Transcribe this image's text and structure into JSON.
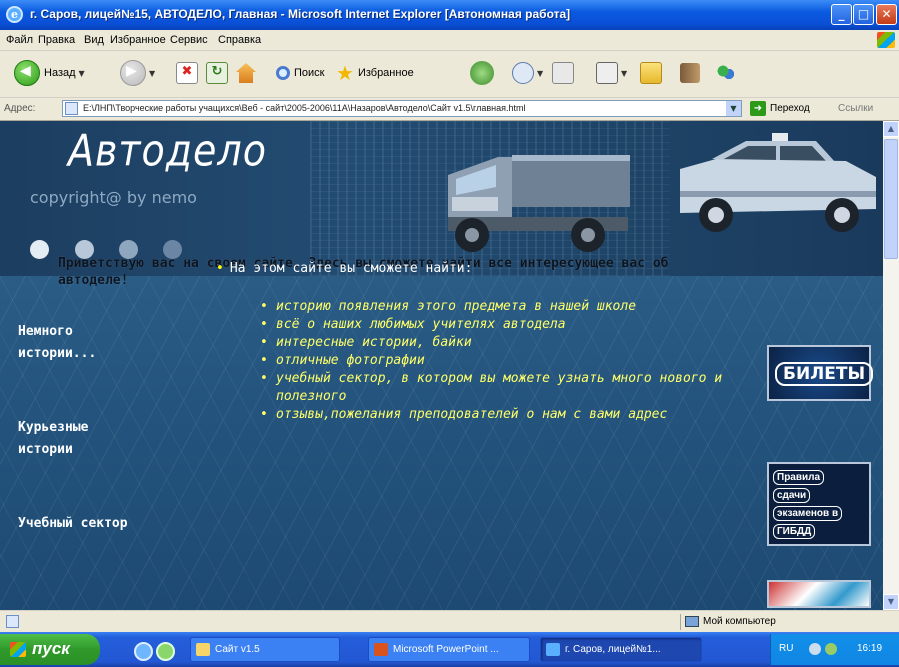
{
  "window": {
    "title": "г. Саров, лицей№15, АВТОДЕЛО, Главная - Microsoft Internet Explorer   [Автономная работа]",
    "min_label": "_",
    "max_label": "□",
    "close_label": "✕"
  },
  "menu": [
    "Файл",
    "Правка",
    "Вид",
    "Избранное",
    "Сервис",
    "Справка"
  ],
  "toolbar": {
    "back_label": "Назад",
    "search_label": "Поиск",
    "favorites_label": "Избранное"
  },
  "address": {
    "label": "Адрес:",
    "url": "E:\\ЛНП\\Творческие работы учащихся\\Веб - сайт\\2005-2006\\11А\\Назаров\\Автодело\\Сайт v1.5\\главная.html",
    "go_label": "Переход",
    "links_label": "Ссылки"
  },
  "page": {
    "site_title": "Автодело",
    "copyright": "copyright@ by nemo",
    "greeting": "Приветствую вас на своем сайте. Здесь вы сможете найти все интересующее вас об автоделе!",
    "sidebar": [
      "Немного истории...",
      "Курьезные истории",
      "Учебный сектор"
    ],
    "intro": "На этом сайте вы сможете найти:",
    "features": [
      "историю появления этого предмета в нашей школе",
      "всё о наших любимых учителях автодела",
      "интересные истории, байки",
      "отличные фотографии",
      "учебный сектор, в котором вы можете узнать много нового и полезного",
      "отзывы,пожелания преподователей о нам с вами адрес"
    ],
    "tickets_button": "БИЛЕТЫ",
    "rules_button": [
      "Правила",
      "сдачи",
      "экзаменов в",
      "ГИБДД"
    ],
    "colors": {
      "accent_text": "#ffff66",
      "background": "#24527a"
    }
  },
  "status": {
    "zone": "Мой компьютер"
  },
  "taskbar": {
    "start": "пуск",
    "tasks": [
      "Сайт v1.5",
      "Microsoft PowerPoint ...",
      "г. Саров, лицей№1..."
    ],
    "lang": "RU",
    "clock": "16:19"
  }
}
